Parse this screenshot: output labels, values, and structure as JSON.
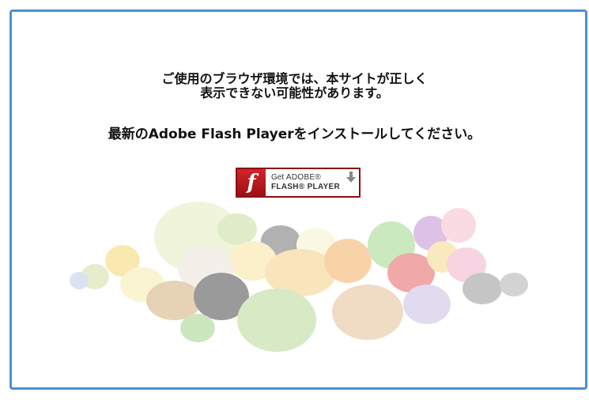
{
  "message": {
    "line1": "ご使用のブラウザ環境では、本サイトが正しく",
    "line2": "表示できない可能性があります。",
    "line3": "最新のAdobe Flash Playerをインストールしてください。"
  },
  "flash_button": {
    "logo_glyph": "f",
    "get_prefix": "Get ",
    "get_brand": "ADOBE®",
    "product": "FLASH® PLAYER",
    "icon": "download-arrow-icon"
  },
  "colors": {
    "frame_border": "#4a90d9",
    "flash_red": "#c81e24"
  }
}
